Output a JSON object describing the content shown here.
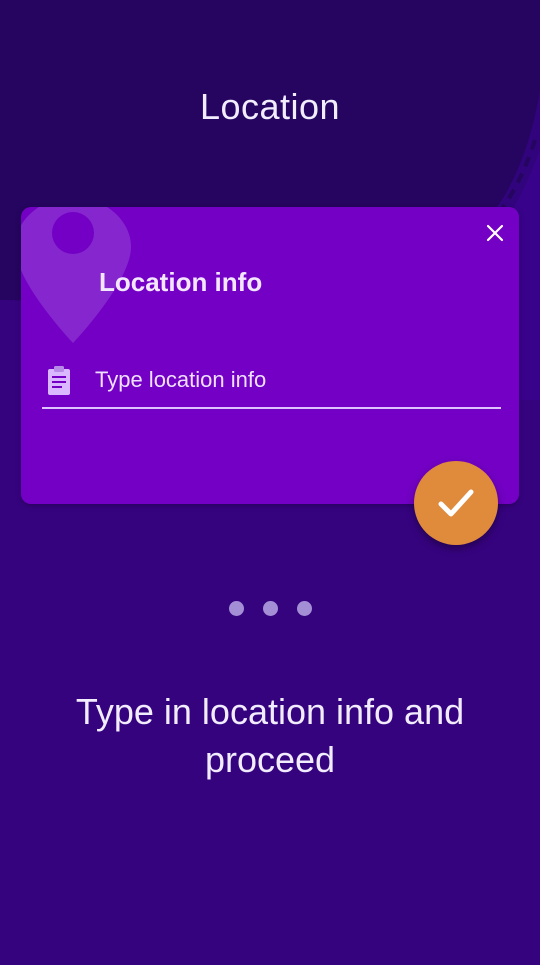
{
  "page": {
    "title": "Location",
    "description": "Type in location info and proceed"
  },
  "card": {
    "title": "Location info",
    "close_icon": "close-icon",
    "decor_icon": "location-pin-icon",
    "field": {
      "icon": "clipboard-icon",
      "value": "",
      "placeholder": "Type location info"
    }
  },
  "confirm_button": {
    "icon": "check-icon"
  },
  "pager": {
    "count": 3
  },
  "colors": {
    "background": "#36037f",
    "background_shape": "#25055f",
    "card": "#7300c4",
    "accent": "#e08a3c",
    "dot": "#a48fd6",
    "underline": "#ddc3ff"
  }
}
